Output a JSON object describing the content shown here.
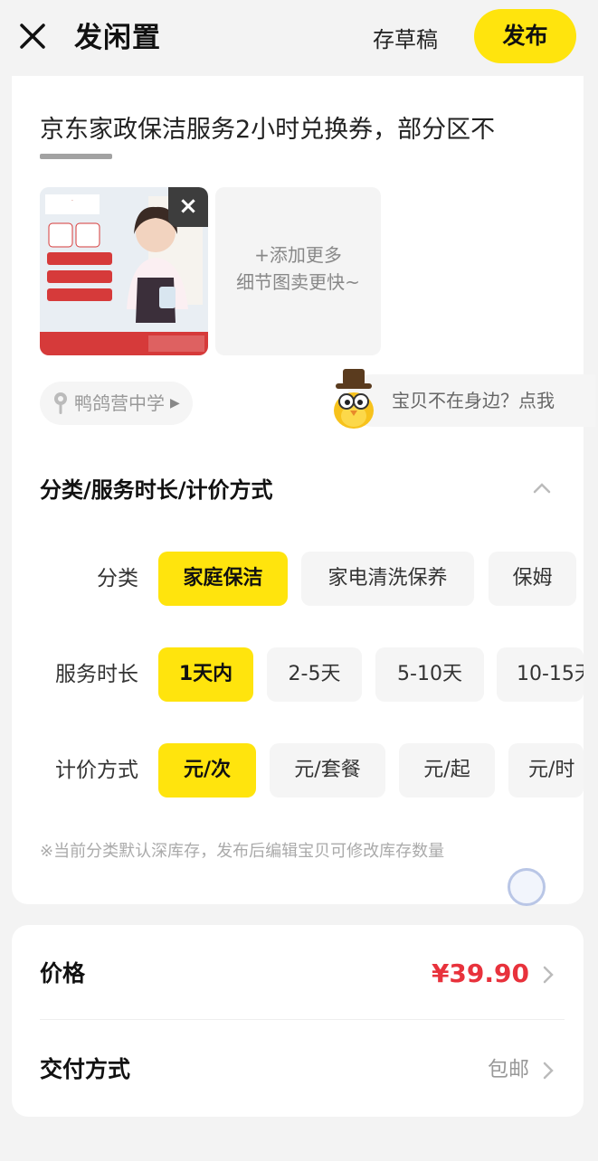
{
  "header": {
    "title": "发闲置",
    "draft_label": "存草稿",
    "publish_label": "发布"
  },
  "listing": {
    "description": "京东家政保洁服务2小时兑换券，部分区不",
    "add_more_line1": "+添加更多",
    "add_more_line2": "细节图卖更快~",
    "location": "鸭鸽营中学",
    "helper_text": "宝贝不在身边？点我"
  },
  "attributes": {
    "section_title": "分类/服务时长/计价方式",
    "category": {
      "label": "分类",
      "options": [
        "家庭保洁",
        "家电清洗保养",
        "保姆"
      ],
      "selected": "家庭保洁"
    },
    "duration": {
      "label": "服务时长",
      "options": [
        "1天内",
        "2-5天",
        "5-10天",
        "10-15天"
      ],
      "selected": "1天内"
    },
    "pricing": {
      "label": "计价方式",
      "options": [
        "元/次",
        "元/套餐",
        "元/起",
        "元/时"
      ],
      "selected": "元/次"
    },
    "note": "※当前分类默认深库存，发布后编辑宝贝可修改库存数量"
  },
  "price": {
    "label": "价格",
    "value": "¥39.90"
  },
  "delivery": {
    "label": "交付方式",
    "value": "包邮"
  },
  "colors": {
    "accent": "#ffe40d",
    "price": "#e8323c"
  }
}
